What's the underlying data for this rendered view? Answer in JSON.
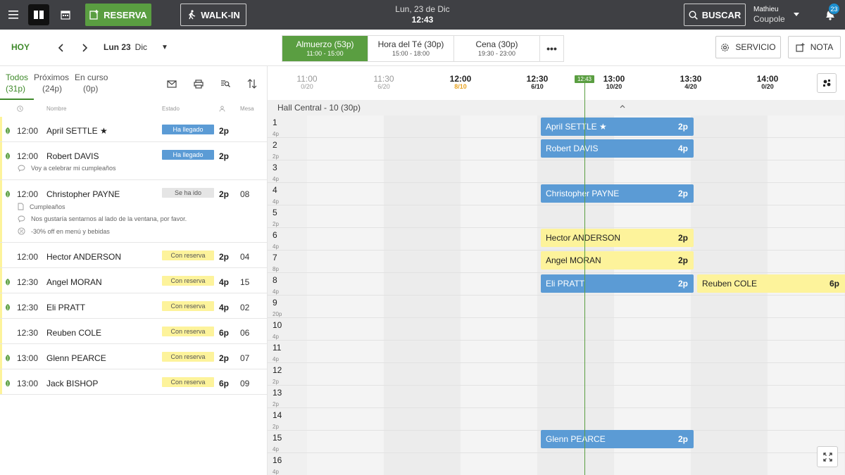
{
  "topbar": {
    "reserva_label": "RESERVA",
    "walkin_label": "WALK-IN",
    "date": "Lun, 23 de Dic",
    "time": "12:43",
    "buscar_label": "BUSCAR",
    "user_first": "Mathieu",
    "user_last": "Coupole",
    "notifications": "23"
  },
  "subheader": {
    "today_label": "HOY",
    "date_day": "Lun 23",
    "date_month": "Dic",
    "services": [
      {
        "name": "Almuerzo (53p)",
        "time": "11:00 - 15:00"
      },
      {
        "name": "Hora del Té (30p)",
        "time": "15:00 - 18:00"
      },
      {
        "name": "Cena (30p)",
        "time": "19:30 - 23:00"
      }
    ],
    "more_label": "•••",
    "servicio_label": "SERVICIO",
    "nota_label": "NOTA"
  },
  "list": {
    "tabs": [
      {
        "label": "Todos",
        "count": "(31p)"
      },
      {
        "label": "Próximos",
        "count": "(24p)"
      },
      {
        "label": "En curso",
        "count": "(0p)"
      }
    ],
    "headers": {
      "name": "Nombre",
      "status": "Estado",
      "table": "Mesa"
    },
    "rows": [
      {
        "time": "12:00",
        "name": "April SETTLE ★",
        "status": "Ha llegado",
        "pax": "2p",
        "table": ""
      },
      {
        "time": "12:00",
        "name": "Robert DAVIS",
        "status": "Ha llegado",
        "pax": "2p",
        "table": "",
        "note1": "Voy a celebrar mi cumpleaños"
      },
      {
        "time": "12:00",
        "name": "Christopher PAYNE",
        "status": "Se ha ido",
        "pax": "2p",
        "table": "08",
        "note1": "Cumpleaños",
        "note2": "Nos gustaría sentarnos al lado de la ventana, por favor.",
        "note3": "-30% off en menú y bebidas"
      },
      {
        "time": "12:00",
        "name": "Hector ANDERSON",
        "status": "Con reserva",
        "pax": "2p",
        "table": "04"
      },
      {
        "time": "12:30",
        "name": "Angel MORAN",
        "status": "Con reserva",
        "pax": "4p",
        "table": "15"
      },
      {
        "time": "12:30",
        "name": "Eli PRATT",
        "status": "Con reserva",
        "pax": "4p",
        "table": "02"
      },
      {
        "time": "12:30",
        "name": "Reuben COLE",
        "status": "Con reserva",
        "pax": "6p",
        "table": "06"
      },
      {
        "time": "13:00",
        "name": "Glenn PEARCE",
        "status": "Con reserva",
        "pax": "2p",
        "table": "07"
      },
      {
        "time": "13:00",
        "name": "Jack BISHOP",
        "status": "Con reserva",
        "pax": "6p",
        "table": "09"
      }
    ]
  },
  "timeline": {
    "slots": [
      {
        "hour": "11:00",
        "cover": "0/20"
      },
      {
        "hour": "11:30",
        "cover": "6/20"
      },
      {
        "hour": "12:00",
        "cover": "8/10"
      },
      {
        "hour": "12:30",
        "cover": "6/10"
      },
      {
        "hour": "13:00",
        "cover": "10/20"
      },
      {
        "hour": "13:30",
        "cover": "4/20"
      },
      {
        "hour": "14:00",
        "cover": "0/20"
      }
    ],
    "now": "12:43",
    "zone": "Hall Central - 10 (30p)",
    "tables": [
      {
        "num": "1",
        "cap": "4p"
      },
      {
        "num": "2",
        "cap": "2p"
      },
      {
        "num": "3",
        "cap": "4p"
      },
      {
        "num": "4",
        "cap": "4p"
      },
      {
        "num": "5",
        "cap": "2p"
      },
      {
        "num": "6",
        "cap": "4p"
      },
      {
        "num": "7",
        "cap": "8p"
      },
      {
        "num": "8",
        "cap": "4p"
      },
      {
        "num": "9",
        "cap": "20p"
      },
      {
        "num": "10",
        "cap": "4p"
      },
      {
        "num": "11",
        "cap": "4p"
      },
      {
        "num": "12",
        "cap": "2p"
      },
      {
        "num": "13",
        "cap": "2p"
      },
      {
        "num": "14",
        "cap": "2p"
      },
      {
        "num": "15",
        "cap": "4p"
      },
      {
        "num": "16",
        "cap": "4p"
      }
    ],
    "bookings": [
      {
        "name": "April SETTLE ★",
        "pax": "2p"
      },
      {
        "name": "Robert DAVIS",
        "pax": "4p"
      },
      {
        "name": "Christopher PAYNE",
        "pax": "2p"
      },
      {
        "name": "Hector ANDERSON",
        "pax": "2p"
      },
      {
        "name": "Angel MORAN",
        "pax": "2p"
      },
      {
        "name": "Eli PRATT",
        "pax": "2p"
      },
      {
        "name": "Reuben COLE",
        "pax": "6p"
      },
      {
        "name": "Glenn PEARCE",
        "pax": "2p"
      }
    ]
  },
  "colors": {
    "green": "#5a9e41",
    "blue": "#5b9bd5",
    "yellow": "#fdf39b",
    "topbar": "#3f4044",
    "warn": "#e8a21f"
  }
}
